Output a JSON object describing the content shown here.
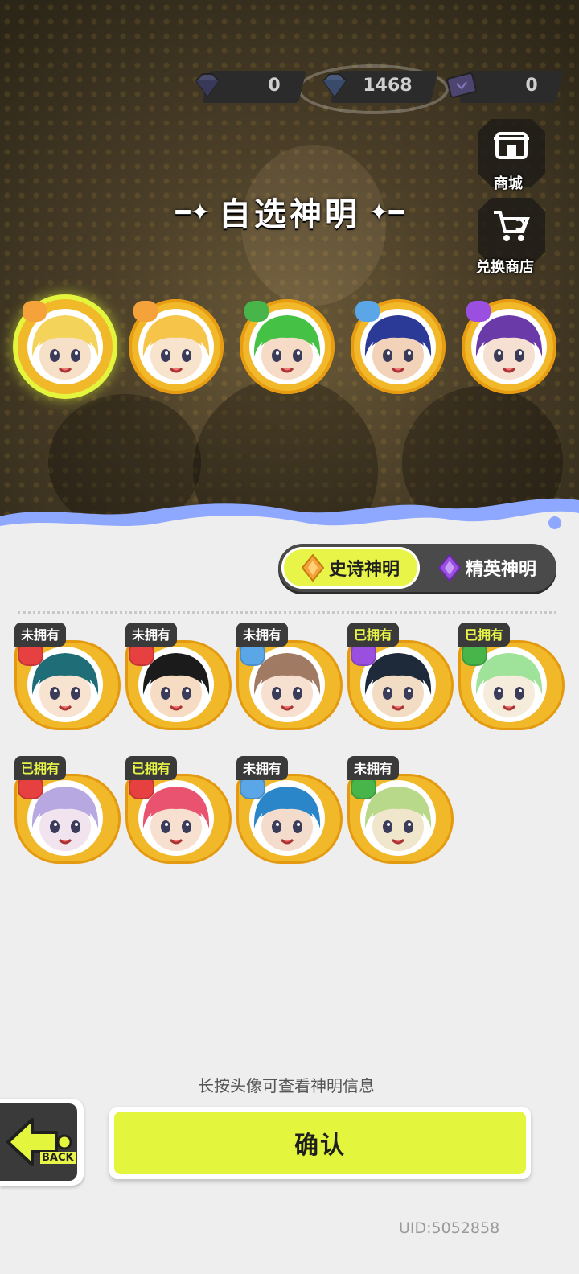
{
  "currency": [
    {
      "icon": "diamond-icon",
      "value": "0"
    },
    {
      "icon": "blue-diamond-icon",
      "value": "1468"
    },
    {
      "icon": "ticket-icon",
      "value": "0"
    }
  ],
  "side": {
    "shop_label": "商城",
    "exchange_label": "兑换商店"
  },
  "title": "自选神明",
  "selected_slots": [
    {
      "pip": "#f5a23a",
      "skin": "#f7e0c8",
      "hair": "#f3d35a",
      "selected": true
    },
    {
      "pip": "#f5a23a",
      "skin": "#f8e3cc",
      "hair": "#f5c448",
      "selected": false
    },
    {
      "pip": "#47b54a",
      "skin": "#f6dcc6",
      "hair": "#45c245",
      "selected": false
    },
    {
      "pip": "#5aa6e6",
      "skin": "#f2d2b8",
      "hair": "#2b3a96",
      "selected": false
    },
    {
      "pip": "#9a4fe0",
      "skin": "#f6e0d2",
      "hair": "#6a3aa8",
      "selected": false
    }
  ],
  "tabs": {
    "epic": "史诗神明",
    "elite": "精英神明"
  },
  "characters": [
    {
      "status": "未拥有",
      "owned": false,
      "pip": "#e74040",
      "skin": "#f8e2d0",
      "hair": "#1f6e77"
    },
    {
      "status": "未拥有",
      "owned": false,
      "pip": "#e74040",
      "skin": "#f6dcc2",
      "hair": "#1b1b1b"
    },
    {
      "status": "未拥有",
      "owned": false,
      "pip": "#5aa6e6",
      "skin": "#f7e0cf",
      "hair": "#a07a62"
    },
    {
      "status": "已拥有",
      "owned": true,
      "pip": "#9a4fe0",
      "skin": "#f2dcc4",
      "hair": "#1e2a3a"
    },
    {
      "status": "已拥有",
      "owned": true,
      "pip": "#47b54a",
      "skin": "#f6ecdc",
      "hair": "#9fe39a"
    },
    {
      "status": "已拥有",
      "owned": true,
      "pip": "#e74040",
      "skin": "#f2e4ee",
      "hair": "#b8a8e2"
    },
    {
      "status": "已拥有",
      "owned": true,
      "pip": "#e74040",
      "skin": "#f8e0d0",
      "hair": "#e9536f"
    },
    {
      "status": "未拥有",
      "owned": false,
      "pip": "#5aa6e6",
      "skin": "#f4dccc",
      "hair": "#2a86c9"
    },
    {
      "status": "未拥有",
      "owned": false,
      "pip": "#47b54a",
      "skin": "#f0e6cc",
      "hair": "#b9d98a"
    }
  ],
  "hint": "长按头像可查看神明信息",
  "back_label": "BACK",
  "confirm_label": "确认",
  "uid": "UID:5052858",
  "colors": {
    "accent": "#e4f53d",
    "gold": "#f1b829",
    "dark": "#3a3a3a"
  }
}
